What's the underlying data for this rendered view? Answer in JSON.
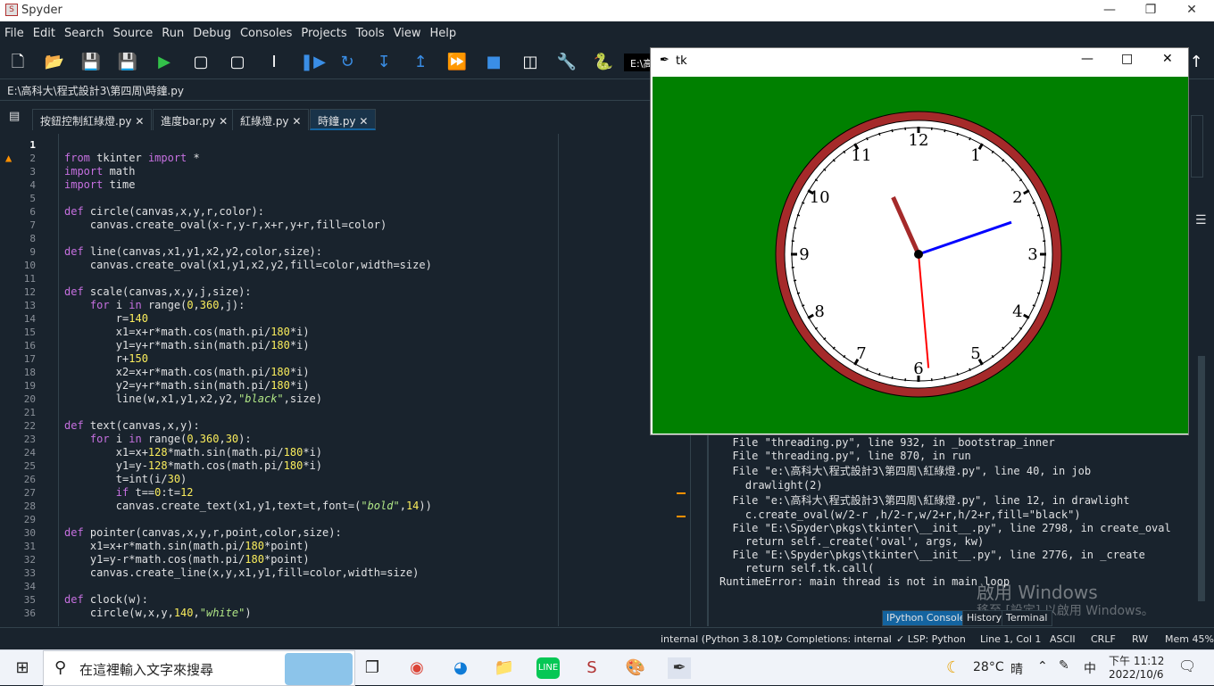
{
  "app": {
    "title": "Spyder"
  },
  "menu": [
    "File",
    "Edit",
    "Search",
    "Source",
    "Run",
    "Debug",
    "Consoles",
    "Projects",
    "Tools",
    "View",
    "Help"
  ],
  "toolbar": {
    "path_prefix": "E:\\高"
  },
  "file_path": "E:\\高科大\\程式設計3\\第四周\\時鐘.py",
  "tabs": [
    {
      "label": "按鈕控制紅綠燈.py",
      "active": false
    },
    {
      "label": "進度bar.py",
      "active": false
    },
    {
      "label": "紅綠燈.py",
      "active": false
    },
    {
      "label": "時鐘.py",
      "active": true
    }
  ],
  "code_lines": [
    "",
    "from tkinter import *",
    "import math",
    "import time",
    "",
    "def circle(canvas,x,y,r,color):",
    "    canvas.create_oval(x-r,y-r,x+r,y+r,fill=color)",
    "",
    "def line(canvas,x1,y1,x2,y2,color,size):",
    "    canvas.create_oval(x1,y1,x2,y2,fill=color,width=size)",
    "",
    "def scale(canvas,x,y,j,size):",
    "    for i in range(0,360,j):",
    "        r=140",
    "        x1=x+r*math.cos(math.pi/180*i)",
    "        y1=y+r*math.sin(math.pi/180*i)",
    "        r+150",
    "        x2=x+r*math.cos(math.pi/180*i)",
    "        y2=y+r*math.sin(math.pi/180*i)",
    "        line(w,x1,y1,x2,y2,\"black\",size)",
    "",
    "def text(canvas,x,y):",
    "    for i in range(0,360,30):",
    "        x1=x+128*math.sin(math.pi/180*i)",
    "        y1=y-128*math.cos(math.pi/180*i)",
    "        t=int(i/30)",
    "        if t==0:t=12",
    "        canvas.create_text(x1,y1,text=t,font=(\"bold\",14))",
    "",
    "def pointer(canvas,x,y,r,point,color,size):",
    "    x1=x+r*math.sin(math.pi/180*point)",
    "    y1=y-r*math.cos(math.pi/180*point)",
    "    canvas.create_line(x,y,x1,y1,fill=color,width=size)",
    "",
    "def clock(w):",
    "    circle(w,x,y,140,\"white\")"
  ],
  "warning_line": 2,
  "console_lines": [
    "  File \"threading.py\", line 932, in _bootstrap_inner",
    "  File \"threading.py\", line 870, in run",
    "  File \"e:\\高科大\\程式設計3\\第四周\\紅綠燈.py\", line 40, in job",
    "    drawlight(2)",
    "  File \"e:\\高科大\\程式設計3\\第四周\\紅綠燈.py\", line 12, in drawlight",
    "    c.create_oval(w/2-r ,h/2-r,w/2+r,h/2+r,fill=\"black\")",
    "  File \"E:\\Spyder\\pkgs\\tkinter\\__init__.py\", line 2798, in create_oval",
    "    return self._create('oval', args, kw)",
    "  File \"E:\\Spyder\\pkgs\\tkinter\\__init__.py\", line 2776, in _create",
    "    return self.tk.call(",
    "RuntimeError: main thread is not in main loop"
  ],
  "console_tabs": [
    "IPython Console",
    "History",
    "Terminal"
  ],
  "status": {
    "interpreter": "internal (Python 3.8.10)",
    "completions": "Completions: internal",
    "lsp": "LSP: Python",
    "position": "Line 1, Col 1",
    "encoding": "ASCII",
    "eol": "CRLF",
    "rw": "RW",
    "mem": "Mem 45%"
  },
  "tk_window": {
    "title": "tk",
    "clock_numbers": [
      "12",
      "1",
      "2",
      "3",
      "4",
      "5",
      "6",
      "7",
      "8",
      "9",
      "10",
      "11"
    ],
    "hands": {
      "hour_deg": -24,
      "minute_deg": 71,
      "second_deg": 175
    }
  },
  "watermark": {
    "line1": "啟用 Windows",
    "line2": "移至 [設定] 以啟用 Windows。"
  },
  "taskbar": {
    "search_placeholder": "在這裡輸入文字來搜尋",
    "weather": "28°C",
    "weather_desc": "晴",
    "ime": "中",
    "time": "下午 11:12",
    "date": "2022/10/6"
  },
  "colors": {
    "bg": "#19232d",
    "canvas_green": "#008000",
    "clock_rim": "#a52a2a",
    "hour_hand": "#a52a2a",
    "minute_hand": "#0000ff",
    "second_hand": "#ff0000"
  }
}
